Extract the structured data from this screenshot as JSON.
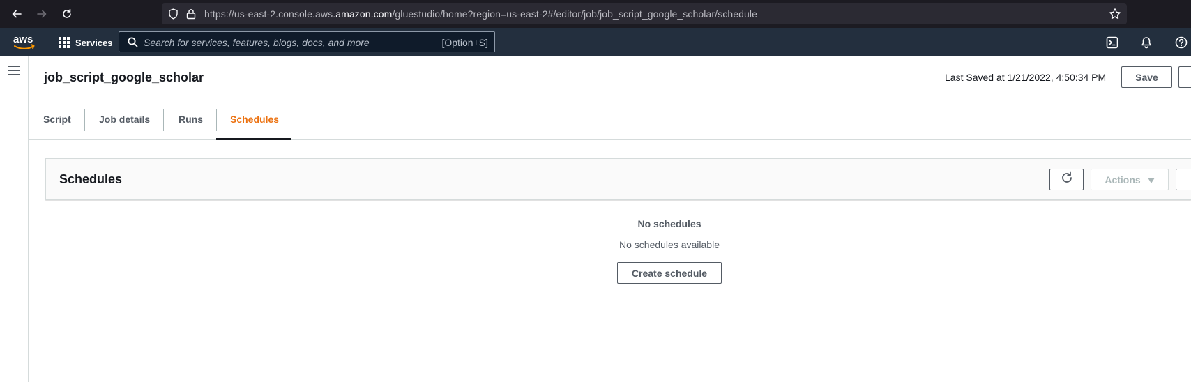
{
  "browser": {
    "url_prefix": "https://us-east-2.console.aws.",
    "url_host": "amazon.com",
    "url_suffix": "/gluestudio/home?region=us-east-2#/editor/job/job_script_google_scholar/schedule",
    "icons": [
      "back-arrow-icon",
      "forward-arrow-icon",
      "reload-icon",
      "shield-icon",
      "lock-icon",
      "star-icon"
    ]
  },
  "aws_nav": {
    "logo_text": "aws",
    "services_label": "Services",
    "search_placeholder": "Search for services, features, blogs, docs, and more",
    "search_shortcut": "[Option+S]",
    "icons": [
      "grid-icon",
      "search-icon",
      "cloudshell-icon",
      "bell-icon",
      "help-icon"
    ]
  },
  "header": {
    "job_title": "job_script_google_scholar",
    "last_saved": "Last Saved at 1/21/2022, 4:50:34 PM",
    "save_label": "Save"
  },
  "tabs": [
    {
      "label": "Script",
      "active": false
    },
    {
      "label": "Job details",
      "active": false
    },
    {
      "label": "Runs",
      "active": false
    },
    {
      "label": "Schedules",
      "active": true
    }
  ],
  "schedules_panel": {
    "title": "Schedules",
    "actions_label": "Actions"
  },
  "empty_state": {
    "title": "No schedules",
    "subtitle": "No schedules available",
    "create_label": "Create schedule"
  },
  "colors": {
    "browser_bg": "#1c1b22",
    "aws_nav_bg": "#232f3e",
    "active_tab": "#ec7211",
    "text_primary": "#16191f",
    "text_secondary": "#545b64"
  }
}
